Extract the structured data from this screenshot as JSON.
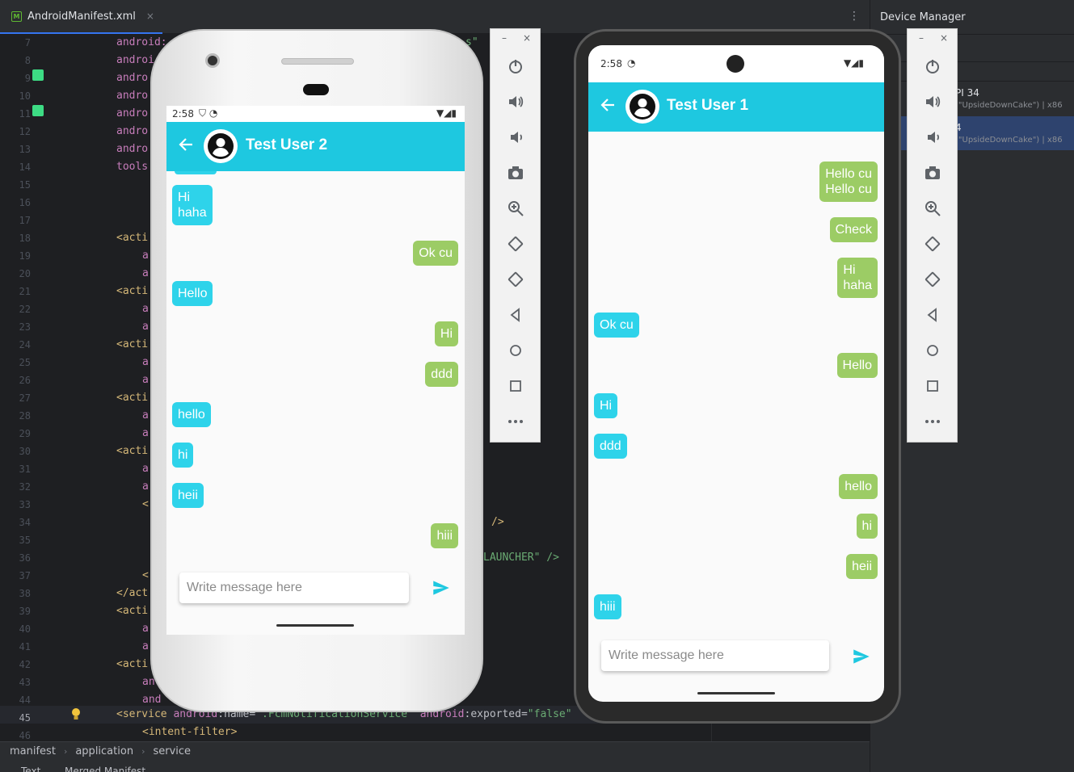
{
  "ide": {
    "tab_label": "AndroidManifest.xml",
    "tab_close": "×",
    "kebab": "⋮",
    "line_numbers": [
      "7",
      "8",
      "9",
      "10",
      "11",
      "12",
      "13",
      "14",
      "15",
      "16",
      "17",
      "18",
      "19",
      "20",
      "21",
      "22",
      "23",
      "24",
      "25",
      "26",
      "27",
      "28",
      "29",
      "30",
      "31",
      "32",
      "33",
      "34",
      "35",
      "36",
      "37",
      "38",
      "39",
      "40",
      "41",
      "42",
      "43",
      "44",
      "45",
      "46"
    ],
    "code_visible": {
      "l7": "android:",
      "l7b": "s\"",
      "l8": "androi",
      "l9": "andro",
      "l10": "andro",
      "l11": "andro",
      "l12": "andro",
      "l13": "andro",
      "l14": "tools",
      "l18": "<acti",
      "l19": "a",
      "l20": "a",
      "l21": "<acti",
      "l22": "a",
      "l23": "a",
      "l24": "<acti",
      "l25": "a",
      "l26": "a",
      "l27": "<acti",
      "l28": "a",
      "l29": "a",
      "l30": "<acti",
      "l31": "a",
      "l32": "a",
      "l33": "<",
      "l34b": "/>",
      "l36b": "LAUNCHER\" />",
      "l37": "<",
      "l38": "</act",
      "l39": "<acti",
      "l40": "a",
      "l41": "a",
      "l42": "<acti",
      "l43": "an",
      "l44": "and",
      "l45a": "<service ",
      "l45b": "android",
      "l45c": ":name=",
      "l45d": "\".FcmNotificationService\"",
      "l45e": " android",
      "l45f": ":exported=",
      "l45g": "\"false\"",
      "l46": "<intent-filter>"
    },
    "breadcrumb": [
      "manifest",
      "application",
      "service"
    ],
    "bottom_tabs": [
      "Text",
      "Merged Manifest"
    ]
  },
  "device_manager": {
    "title": "Device Manager",
    "devices": [
      {
        "name": "PI 34",
        "sub": "(\"UpsideDownCake\") | x86"
      },
      {
        "name": "4",
        "sub": "(\"UpsideDownCake\") | x86"
      }
    ]
  },
  "toolbar": {
    "minimize": "–",
    "close": "×",
    "items": [
      "power-icon",
      "volume-up-icon",
      "volume-down-icon",
      "camera-icon",
      "zoom-icon",
      "rotate-left-icon",
      "rotate-right-icon",
      "back-icon",
      "home-icon",
      "overview-icon",
      "more-icon"
    ]
  },
  "phone1": {
    "time": "2:58",
    "status_icons": "▼◢▮",
    "title": "Test User 2",
    "messages": [
      {
        "text": "Hi\nhaha",
        "dir": "in"
      },
      {
        "text": "Ok cu",
        "dir": "out"
      },
      {
        "text": "Hello",
        "dir": "in"
      },
      {
        "text": "Hi",
        "dir": "out"
      },
      {
        "text": "ddd",
        "dir": "out"
      },
      {
        "text": "hello",
        "dir": "in"
      },
      {
        "text": "hi",
        "dir": "in"
      },
      {
        "text": "heii",
        "dir": "in"
      },
      {
        "text": "hiii",
        "dir": "out"
      }
    ],
    "placeholder": "Write message here"
  },
  "phone2": {
    "time": "2:58",
    "status_icons": "▼◢▮",
    "title": "Test User 1",
    "messages": [
      {
        "text": "Hello cu\nHello cu",
        "dir": "out"
      },
      {
        "text": "Check",
        "dir": "out"
      },
      {
        "text": "Hi\nhaha",
        "dir": "out"
      },
      {
        "text": "Ok cu",
        "dir": "in"
      },
      {
        "text": "Hello",
        "dir": "out"
      },
      {
        "text": "Hi",
        "dir": "in"
      },
      {
        "text": "ddd",
        "dir": "in"
      },
      {
        "text": "hello",
        "dir": "out"
      },
      {
        "text": "hi",
        "dir": "out"
      },
      {
        "text": "heii",
        "dir": "out"
      },
      {
        "text": "hiii",
        "dir": "in"
      }
    ],
    "placeholder": "Write message here"
  },
  "colors": {
    "appbar": "#1ec8e0",
    "incoming_bubble": "#2ed3ea",
    "outgoing_bubble": "#9ccc65",
    "send_icon": "#1ec8e0"
  }
}
